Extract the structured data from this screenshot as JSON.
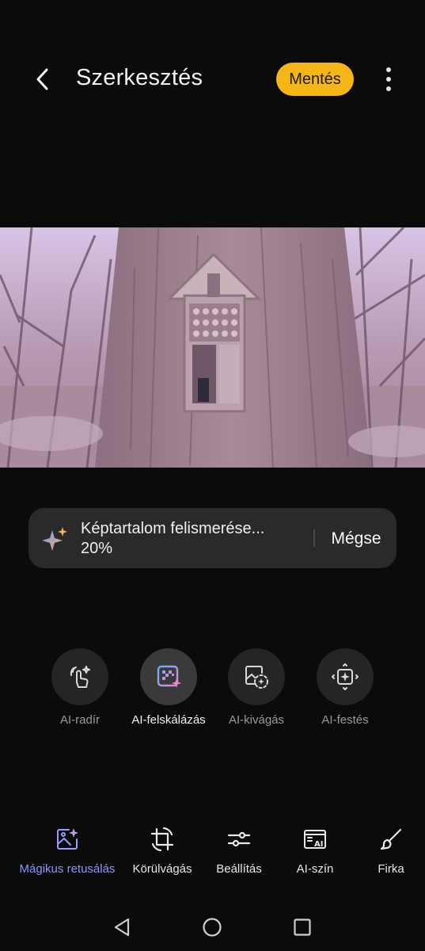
{
  "header": {
    "title": "Szerkesztés",
    "save_label": "Mentés",
    "back_icon": "chevron-left-icon",
    "more_icon": "more-vertical-icon"
  },
  "toast": {
    "message": "Képtartalom felismerése...",
    "progress_text": "20%",
    "progress": 0.2,
    "cancel_label": "Mégse",
    "icon": "sparkle-icon"
  },
  "tools": [
    {
      "label": "AI-radír",
      "icon": "ai-eraser-icon",
      "active": false
    },
    {
      "label": "AI-felskálázás",
      "icon": "ai-upscale-icon",
      "active": true
    },
    {
      "label": "AI-kivágás",
      "icon": "ai-cutout-icon",
      "active": false
    },
    {
      "label": "AI-festés",
      "icon": "ai-paint-icon",
      "active": false
    }
  ],
  "tabs": [
    {
      "label": "Mágikus retusálás",
      "icon": "magic-retouch-icon",
      "active": true
    },
    {
      "label": "Körülvágás",
      "icon": "crop-icon",
      "active": false
    },
    {
      "label": "Beállítás",
      "icon": "sliders-icon",
      "active": false
    },
    {
      "label": "AI-szín",
      "icon": "ai-color-icon",
      "active": false
    },
    {
      "label": "Firka",
      "icon": "brush-icon",
      "active": false
    }
  ],
  "colors": {
    "background": "#0b0b0b",
    "save_button": "#f5b616",
    "accent": "#8f95ff",
    "toast_background": "#2a2a2a",
    "image_overlay": "#c9a8e8"
  }
}
